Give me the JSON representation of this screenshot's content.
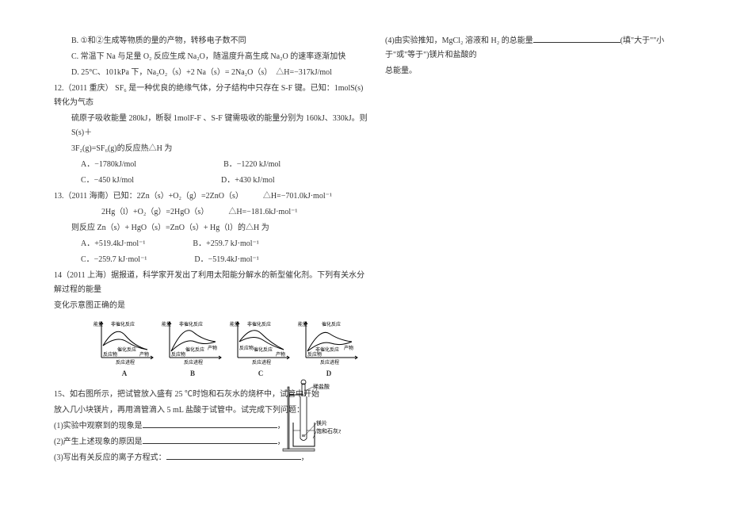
{
  "left": {
    "optB": "B. ①和②生成等物质的量的产物，转移电子数不同",
    "optC": "C. 常温下 Na 与足量 O₂ 反应生成 Na₂O，随温度升高生成 Na₂O 的速率逐渐加快",
    "optD": "D. 25°C、101kPa 下，Na₂O₂（s）+2 Na（s）= 2Na₂O（s）　△H=−317kJ/mol",
    "q12_stem": "12.（2011 重庆） SF₆ 是一种优良的绝缘气体，分子结构中只存在 S-F 键。已知：1molS(s)转化为气态",
    "q12_stem2": "硫原子吸收能量 280kJ，断裂 1molF-F 、S-F 键需吸收的能量分别为 160kJ、330kJ。则 S(s)＋",
    "q12_stem3": "3F₂(g)=SF₆(g)的反应热△H 为",
    "q12_A": "A．−1780kJ/mol",
    "q12_B": "B．−1220 kJ/mol",
    "q12_C": "C．−450 kJ/mol",
    "q12_D": "D．+430 kJ/mol",
    "q13_stem": "13.（2011 海南）已知：2Zn（s）+O₂（g）=2ZnO（s）　　　△H=−701.0kJ·mol⁻¹",
    "q13_eq2": "2Hg（l）+O₂（g）=2HgO（s）　　　△H=−181.6kJ·mol⁻¹",
    "q13_ask": "则反应 Zn（s）+ HgO（s）=ZnO（s）+ Hg（l）的△H 为",
    "q13_A": "A．+519.4kJ·mol⁻¹",
    "q13_B": "B．+259.7 kJ·mol⁻¹",
    "q13_C": "C．−259.7 kJ·mol⁻¹",
    "q13_D": "D．−519.4kJ·mol⁻¹",
    "q14_stem": "14（2011 上海）据报道，科学家开发出了利用太阳能分解水的新型催化剂。下列有关水分解过程的能量",
    "q14_stem2": "变化示意图正确的是",
    "graph_txt": {
      "y": "能量",
      "x": "反应进程",
      "fei": "非催化反应",
      "cui": "催化反应",
      "fyw": "反应物",
      "cw": "产物",
      "A": "A",
      "B": "B",
      "C": "C",
      "D": "D"
    },
    "q15_stem": "15、如右图所示，把试管放入盛有 25 ℃时饱和石灰水的烧杯中，试管中开始",
    "q15_stem2": "放入几小块镁片，再用滴管滴入 5 mL 盐酸于试管中。试完成下列问题：",
    "q15_1": "(1)实验中观察到的现象是",
    "q15_2": "(2)产生上述现象的原因是",
    "q15_3": "(3)写出有关反应的离子方程式：",
    "diagram": {
      "xys": "稀盐酸",
      "mp": "镁片",
      "bhs": "饱和石灰水"
    }
  },
  "right": {
    "q15_4a": "(4)由实验推知，MgCl₂ 溶液和 H₂ 的总能量",
    "q15_4b": "(填\"大于\"\"小于\"或\"等于\")镁片和盐酸的",
    "q15_4c": "总能量。"
  }
}
